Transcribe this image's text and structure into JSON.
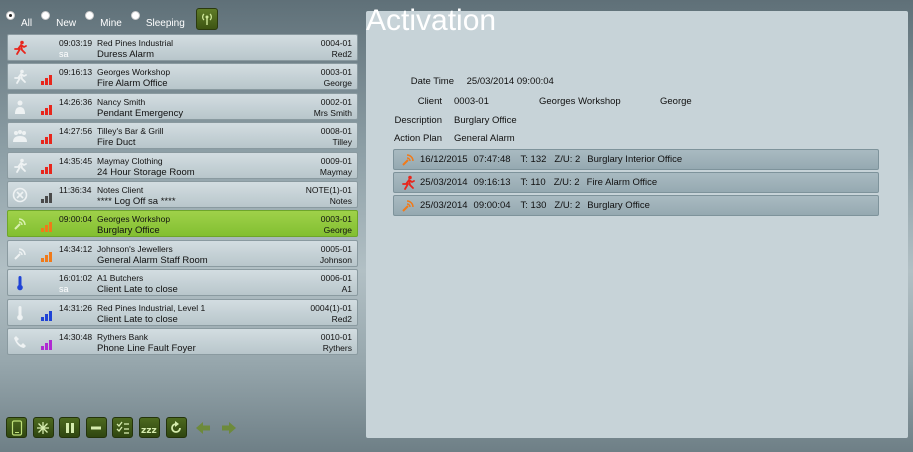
{
  "filters": [
    {
      "label": "All",
      "selected": true
    },
    {
      "label": "New",
      "selected": false
    },
    {
      "label": "Mine",
      "selected": false
    },
    {
      "label": "Sleeping",
      "selected": false
    }
  ],
  "alarms": [
    {
      "time": "09:03:19",
      "user": "sa",
      "client": "Red Pines Industrial",
      "event": "Duress Alarm",
      "code": "0004-01",
      "name": "Red2",
      "icon": "running-person-icon",
      "signal": "none"
    },
    {
      "time": "09:16:13",
      "user": "",
      "client": "Georges Workshop",
      "event": "Fire Alarm Office",
      "code": "0003-01",
      "name": "George",
      "icon": "running-person-icon",
      "signal": "red"
    },
    {
      "time": "14:26:36",
      "user": "",
      "client": "Nancy Smith",
      "event": "Pendant Emergency",
      "code": "0002-01",
      "name": "Mrs Smith",
      "icon": "pendant-icon",
      "signal": "red"
    },
    {
      "time": "14:27:56",
      "user": "",
      "client": "Tilley's Bar & Grill",
      "event": "Fire Duct",
      "code": "0008-01",
      "name": "Tilley",
      "icon": "group-icon",
      "signal": "red"
    },
    {
      "time": "14:35:45",
      "user": "",
      "client": "Maymay Clothing",
      "event": "24 Hour Storage Room",
      "code": "0009-01",
      "name": "Maymay",
      "icon": "running-person-icon",
      "signal": "red"
    },
    {
      "time": "11:36:34",
      "user": "",
      "client": "Notes Client",
      "event": "**** Log Off sa ****",
      "code": "NOTE(1)-01",
      "name": "Notes",
      "icon": "cancel-circle-icon",
      "signal": "grey"
    },
    {
      "time": "09:00:04",
      "user": "",
      "client": "Georges Workshop",
      "event": "Burglary Office",
      "code": "0003-01",
      "name": "George",
      "icon": "motion-sensor-icon",
      "signal": "orange",
      "selected": true
    },
    {
      "time": "14:34:12",
      "user": "",
      "client": "Johnson's Jewellers",
      "event": "General Alarm Staff Room",
      "code": "0005-01",
      "name": "Johnson",
      "icon": "motion-sensor-icon",
      "signal": "orange"
    },
    {
      "time": "16:01:02",
      "user": "sa",
      "client": "A1 Butchers",
      "event": "Client Late to close",
      "code": "0006-01",
      "name": "A1",
      "icon": "thermometer-icon",
      "signal": "none"
    },
    {
      "time": "14:31:26",
      "user": "",
      "client": "Red Pines Industrial, Level 1",
      "event": "Client Late to close",
      "code": "0004(1)-01",
      "name": "Red2",
      "icon": "thermometer-icon",
      "signal": "blue"
    },
    {
      "time": "14:30:48",
      "user": "",
      "client": "Rythers Bank",
      "event": "Phone Line Fault Foyer",
      "code": "0010-01",
      "name": "Rythers",
      "icon": "phone-icon",
      "signal": "purple"
    }
  ],
  "activation": {
    "title": "Activation",
    "date_time_label": "Date Time",
    "date_time": "25/03/2014 09:00:04",
    "client_label": "Client",
    "client_code": "0003-01",
    "client_name": "Georges Workshop",
    "client_contact": "George",
    "description_label": "Description",
    "description": "Burglary Office",
    "action_plan_label": "Action Plan",
    "action_plan": "General Alarm",
    "history": [
      {
        "date": "16/12/2015",
        "time": "07:47:48",
        "t": "T: 132",
        "zu": "Z/U: 2",
        "event": "Burglary Interior Office",
        "icon": "motion-sensor-icon"
      },
      {
        "date": "25/03/2014",
        "time": "09:16:13",
        "t": "T: 110",
        "zu": "Z/U: 2",
        "event": "Fire Alarm Office",
        "icon": "running-person-icon"
      },
      {
        "date": "25/03/2014",
        "time": "09:00:04",
        "t": "T: 130",
        "zu": "Z/U: 2",
        "event": "Burglary Office",
        "icon": "motion-sensor-icon"
      }
    ]
  },
  "toolbar": [
    {
      "icon": "phone-device-icon"
    },
    {
      "icon": "sparkle-icon"
    },
    {
      "icon": "pause-icon"
    },
    {
      "icon": "minus-icon"
    },
    {
      "icon": "checklist-icon"
    },
    {
      "icon": "sleep-icon"
    },
    {
      "icon": "refresh-icon"
    },
    {
      "icon": "arrow-left-icon"
    },
    {
      "icon": "arrow-right-icon"
    }
  ],
  "colors": {
    "selected_row": "#8ec63f",
    "signal_red": "#e8261c",
    "signal_orange": "#f07a1a",
    "signal_blue": "#1f43d6",
    "signal_purple": "#b02ad2",
    "signal_grey": "#4a4a4a"
  }
}
